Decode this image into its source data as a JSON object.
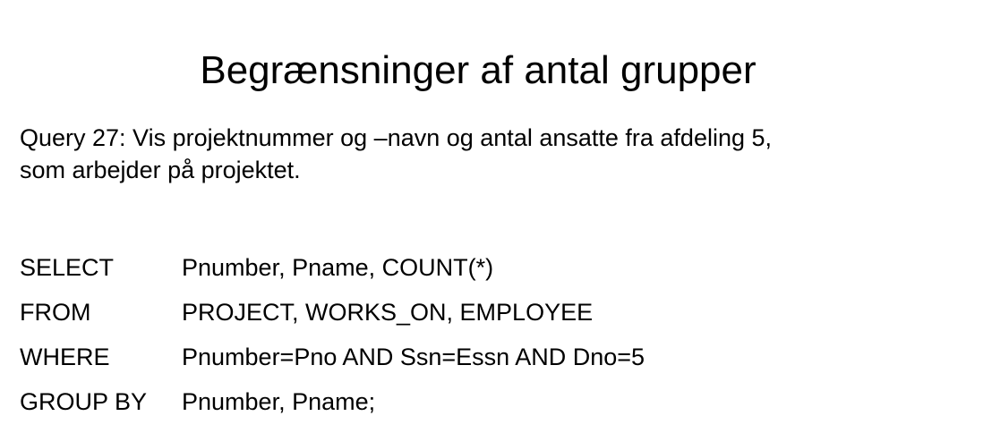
{
  "slide": {
    "title": "Begrænsninger af antal grupper",
    "description": {
      "line1": "Query 27: Vis projektnummer og –navn og antal ansatte fra afdeling 5,",
      "line2": "som arbejder på projektet."
    },
    "sql": [
      {
        "keyword": "SELECT",
        "clause": "Pnumber, Pname, COUNT(*)"
      },
      {
        "keyword": "FROM",
        "clause": "PROJECT, WORKS_ON, EMPLOYEE"
      },
      {
        "keyword": "WHERE",
        "clause": "Pnumber=Pno AND Ssn=Essn AND Dno=5"
      },
      {
        "keyword": "GROUP BY",
        "clause": "Pnumber, Pname;"
      }
    ]
  }
}
